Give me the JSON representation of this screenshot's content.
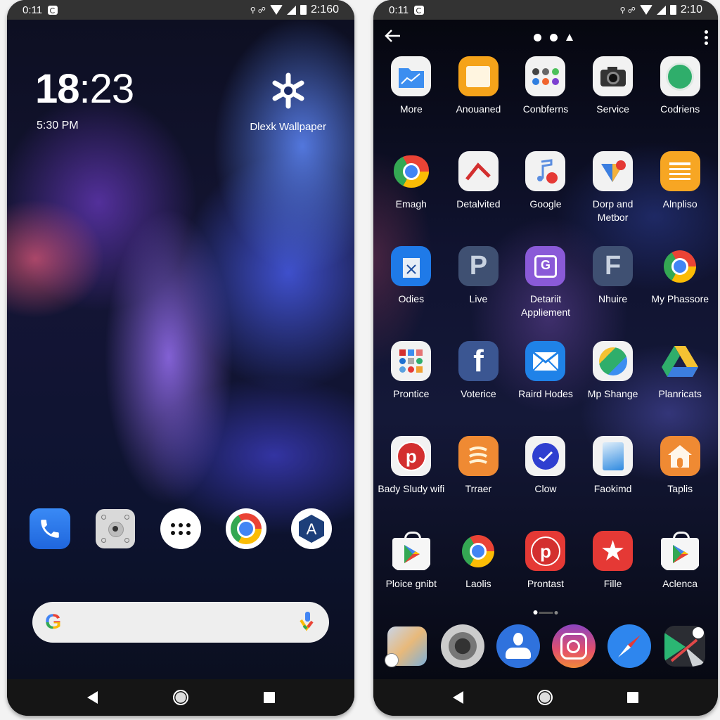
{
  "left_phone": {
    "statusbar": {
      "time_left": "0:11",
      "time_right": "2:160"
    },
    "clock": {
      "hour": "18",
      "minute": ":23",
      "subtext": "5:30 PM"
    },
    "widget": {
      "label": "Dlexk Wallpaper",
      "icon": "gear-icon"
    },
    "dock": [
      {
        "name": "Phone",
        "icon": "phone-icon",
        "color": "#2f7cf0"
      },
      {
        "name": "Camera",
        "icon": "camera-icon",
        "color": "#dcdcdc"
      },
      {
        "name": "App drawer",
        "icon": "app-drawer-icon",
        "color": "#ffffff"
      },
      {
        "name": "Chrome",
        "icon": "chrome-icon",
        "color": "#ffffff"
      },
      {
        "name": "Store",
        "icon": "store-icon",
        "color": "#ffffff"
      }
    ],
    "searchbar": {
      "logo": "G",
      "placeholder": ""
    }
  },
  "right_phone": {
    "statusbar": {
      "time_left": "0:11",
      "time_right": "2:10"
    },
    "apps": [
      {
        "label": "More",
        "icon": "folder-chart-icon",
        "bg": "#f2f2f2"
      },
      {
        "label": "Anouaned",
        "icon": "calendar-icon",
        "bg": "#f5a31a"
      },
      {
        "label": "Conbferns",
        "icon": "dots-icon",
        "bg": "#f2f2f2"
      },
      {
        "label": "Service",
        "icon": "camera-icon",
        "bg": "#f2f2f2"
      },
      {
        "label": "Codriens",
        "icon": "green-circle-icon",
        "bg": "#f2f2f2"
      },
      {
        "label": "Emagh",
        "icon": "chrome-heart-icon",
        "bg": "transparent"
      },
      {
        "label": "Detalvited",
        "icon": "chevron-icon",
        "bg": "#f2f2f2"
      },
      {
        "label": "Google",
        "icon": "music-note-icon",
        "bg": "#f2f2f2"
      },
      {
        "label": "Dorp and Metbor",
        "icon": "heart-badge-icon",
        "bg": "#f2f2f2"
      },
      {
        "label": "Alnpliso",
        "icon": "notes-icon",
        "bg": "#f7a623"
      },
      {
        "label": "Odies",
        "icon": "bag-x-icon",
        "bg": "#1f7ae8"
      },
      {
        "label": "Live",
        "icon": "p-letter-icon",
        "bg": "#3f5072"
      },
      {
        "label": "Detariit Appliement",
        "icon": "gallery-icon",
        "bg": "#8a5ad8"
      },
      {
        "label": "Nhuire",
        "icon": "f-letter-icon",
        "bg": "#3f5072"
      },
      {
        "label": "My Phassore",
        "icon": "chrome-icon",
        "bg": "transparent"
      },
      {
        "label": "Prontice",
        "icon": "app-folder-icon",
        "bg": "#f2f2f2"
      },
      {
        "label": "Voterice",
        "icon": "facebook-icon",
        "bg": "#3b5692"
      },
      {
        "label": "Raird Hodes",
        "icon": "mail-icon",
        "bg": "#1f82e8"
      },
      {
        "label": "Mp Shange",
        "icon": "map-icon",
        "bg": "#f2f2f2"
      },
      {
        "label": "Planricats",
        "icon": "drive-icon",
        "bg": "transparent"
      },
      {
        "label": "Bady Sludy wifi",
        "icon": "pinterest-icon",
        "bg": "#f2f2f2"
      },
      {
        "label": "Trraer",
        "icon": "waves-icon",
        "bg": "#ef8a33"
      },
      {
        "label": "Clow",
        "icon": "check-circle-icon",
        "bg": "#f2f2f2"
      },
      {
        "label": "Faokimd",
        "icon": "document-icon",
        "bg": "#f2f2f2"
      },
      {
        "label": "Taplis",
        "icon": "home-icon",
        "bg": "#ef8a33"
      },
      {
        "label": "Ploice gnibt",
        "icon": "play-store-icon",
        "bg": "transparent"
      },
      {
        "label": "Laolis",
        "icon": "chrome-icon",
        "bg": "transparent"
      },
      {
        "label": "Prontast",
        "icon": "pinterest-icon",
        "bg": "#e53935"
      },
      {
        "label": "Fille",
        "icon": "star-icon",
        "bg": "#e53935"
      },
      {
        "label": "Aclenca",
        "icon": "play-store-icon",
        "bg": "transparent"
      }
    ],
    "page_indicator": {
      "current": 1,
      "total": 2
    },
    "dock": [
      {
        "name": "Gallery",
        "icon": "gallery-collage-icon"
      },
      {
        "name": "Camera",
        "icon": "camera-lens-icon"
      },
      {
        "name": "Contacts",
        "icon": "contacts-icon"
      },
      {
        "name": "Instagram",
        "icon": "instagram-icon"
      },
      {
        "name": "Compass",
        "icon": "compass-icon"
      },
      {
        "name": "Play",
        "icon": "play-dark-icon"
      }
    ]
  }
}
